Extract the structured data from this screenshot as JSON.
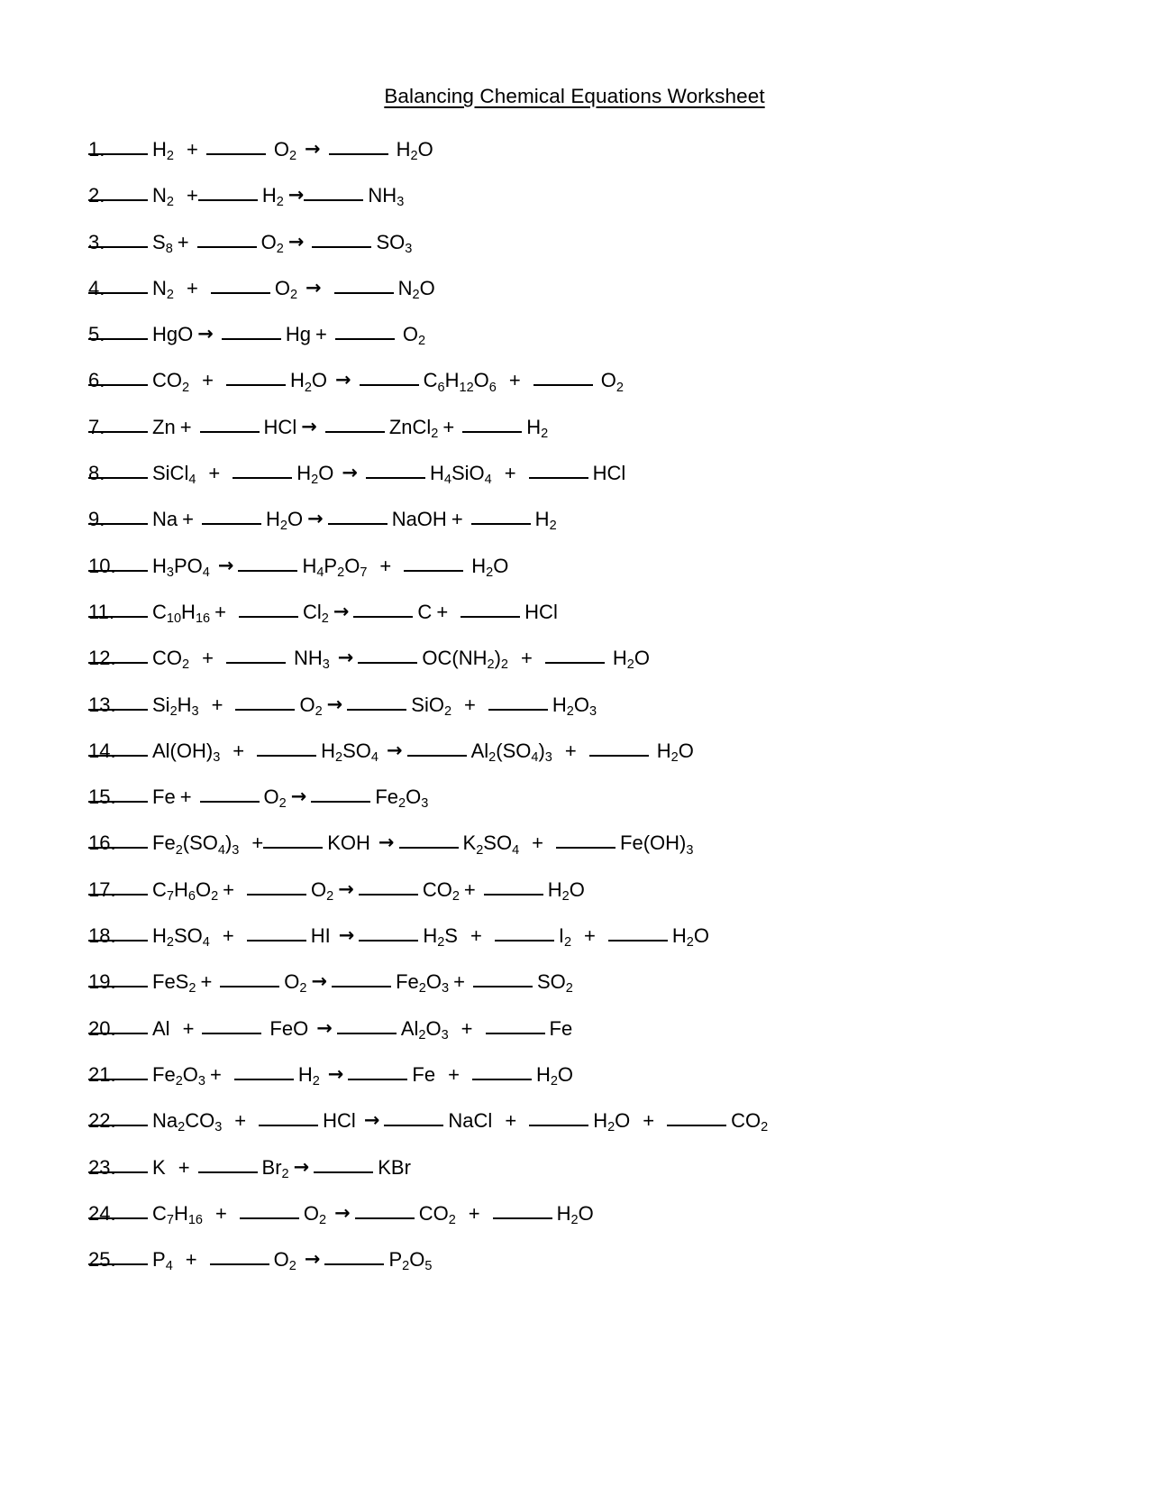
{
  "document": {
    "title": "Balancing Chemical Equations Worksheet",
    "blank_symbol": "_____",
    "arrow_symbol": "→",
    "plus_symbol": "+"
  },
  "equations": [
    {
      "number": "1.",
      "reactants": [
        "H2",
        "O2"
      ],
      "products": [
        "H2O"
      ],
      "text": "_____ H2  + _____ O2 → _____ H2O"
    },
    {
      "number": "2.",
      "reactants": [
        "N2",
        "H2"
      ],
      "products": [
        "NH3"
      ],
      "text": "_____ N2  +_____ H2 →_____ NH3"
    },
    {
      "number": "3.",
      "reactants": [
        "S8",
        "O2"
      ],
      "products": [
        "SO3"
      ],
      "text": "_____ S8 + _____ O2 → _____ SO3"
    },
    {
      "number": "4.",
      "reactants": [
        "N2",
        "O2"
      ],
      "products": [
        "N2O"
      ],
      "text": "_____ N2  + _____ O2 → _____ N2O"
    },
    {
      "number": "5.",
      "reactants": [
        "HgO"
      ],
      "products": [
        "Hg",
        "O2"
      ],
      "text": "_____ HgO → _____ Hg + _____ O2"
    },
    {
      "number": "6.",
      "reactants": [
        "CO2",
        "H2O"
      ],
      "products": [
        "C6H12O6",
        "O2"
      ],
      "text": "_____ CO2  + _____ H2O → _____ C6H12O6  + _____ O2"
    },
    {
      "number": "7.",
      "reactants": [
        "Zn",
        "HCl"
      ],
      "products": [
        "ZnCl2",
        "H2"
      ],
      "text": "_____ Zn + _____ HCl → _____ ZnCl2 + _____ H2"
    },
    {
      "number": "8.",
      "reactants": [
        "SiCl4",
        "H2O"
      ],
      "products": [
        "H4SiO4",
        "HCl"
      ],
      "text": "_____ SiCl4  + _____ H2O → _____ H4SiO4  + _____ HCl"
    },
    {
      "number": "9.",
      "reactants": [
        "Na",
        "H2O"
      ],
      "products": [
        "NaOH",
        "H2"
      ],
      "text": "_____ Na + _____ H2O → _____ NaOH + _____ H2"
    },
    {
      "number": "10.",
      "reactants": [
        "H3PO4"
      ],
      "products": [
        "H4P2O7",
        "H2O"
      ],
      "text": "_____ H3PO4 → _____ H4P2O7  + _____ H2O"
    },
    {
      "number": "11.",
      "reactants": [
        "C10H16",
        "Cl2"
      ],
      "products": [
        "C",
        "HCl"
      ],
      "text": "_____ C10H16 + _____ Cl2 → _____ C + _____ HCl"
    },
    {
      "number": "12.",
      "reactants": [
        "CO2",
        "NH3"
      ],
      "products": [
        "OC(NH2)2",
        "H2O"
      ],
      "text": "_____ CO2  + _____ NH3 → _____ OC(NH2)2  + _____ H2O"
    },
    {
      "number": "13.",
      "reactants": [
        "Si2H3",
        "O2"
      ],
      "products": [
        "SiO2",
        "H2O3"
      ],
      "text": "_____ Si2H3  + _____ O2 → _____ SiO2  + _____ H2O3"
    },
    {
      "number": "14.",
      "reactants": [
        "Al(OH)3",
        "H2SO4"
      ],
      "products": [
        "Al2(SO4)3",
        "H2O"
      ],
      "text": "_____ Al(OH)3  + _____ H2SO4 → _____ Al2(SO4)3  + _____ H2O"
    },
    {
      "number": "15.",
      "reactants": [
        "Fe",
        "O2"
      ],
      "products": [
        "Fe2O3"
      ],
      "text": "_____ Fe + _____ O2 → _____ Fe2O3"
    },
    {
      "number": "16.",
      "reactants": [
        "Fe2(SO4)3",
        "KOH"
      ],
      "products": [
        "K2SO4",
        "Fe(OH)3"
      ],
      "text": "_____ Fe2(SO4)3  + _____ KOH → _____ K2SO4  + _____ Fe(OH)3"
    },
    {
      "number": "17.",
      "reactants": [
        "C7H6O2",
        "O2"
      ],
      "products": [
        "CO2",
        "H2O"
      ],
      "text": "_____ C7H6O2 + _____ O2 → _____ CO2 + _____ H2O"
    },
    {
      "number": "18.",
      "reactants": [
        "H2SO4",
        "HI"
      ],
      "products": [
        "H2S",
        "I2",
        "H2O"
      ],
      "text": "_____ H2SO4  + _____ HI → _____ H2S  + _____ I2  + _____ H2O"
    },
    {
      "number": "19.",
      "reactants": [
        "FeS2",
        "O2"
      ],
      "products": [
        "Fe2O3",
        "SO2"
      ],
      "text": "_____ FeS2 + _____ O2 → _____ Fe2O3 + _____ SO2"
    },
    {
      "number": "20.",
      "reactants": [
        "Al",
        "FeO"
      ],
      "products": [
        "Al2O3",
        "Fe"
      ],
      "text": "_____ Al  + _____ FeO → _____ Al2O3  + _____ Fe"
    },
    {
      "number": "21.",
      "reactants": [
        "Fe2O3",
        "H2"
      ],
      "products": [
        "Fe",
        "H2O"
      ],
      "text": "_____ Fe2O3 + _____ H2 → _____ Fe  + _____ H2O"
    },
    {
      "number": "22.",
      "reactants": [
        "Na2CO3",
        "HCl"
      ],
      "products": [
        "NaCl",
        "H2O",
        "CO2"
      ],
      "text": "_____ Na2CO3  + _____ HCl → _____ NaCl  + _____ H2O  + _____ CO2"
    },
    {
      "number": "23.",
      "reactants": [
        "K",
        "Br2"
      ],
      "products": [
        "KBr"
      ],
      "text": "_____ K  + _____ Br2 → _____ KBr"
    },
    {
      "number": "24.",
      "reactants": [
        "C7H16",
        "O2"
      ],
      "products": [
        "CO2",
        "H2O"
      ],
      "text": "_____ C7H16  + _____ O2 → _____ CO2  + _____ H2O"
    },
    {
      "number": "25.",
      "reactants": [
        "P4",
        "O2"
      ],
      "products": [
        "P2O5"
      ],
      "text": "_____ P4  + _____ O2 → _____ P2O5"
    }
  ]
}
